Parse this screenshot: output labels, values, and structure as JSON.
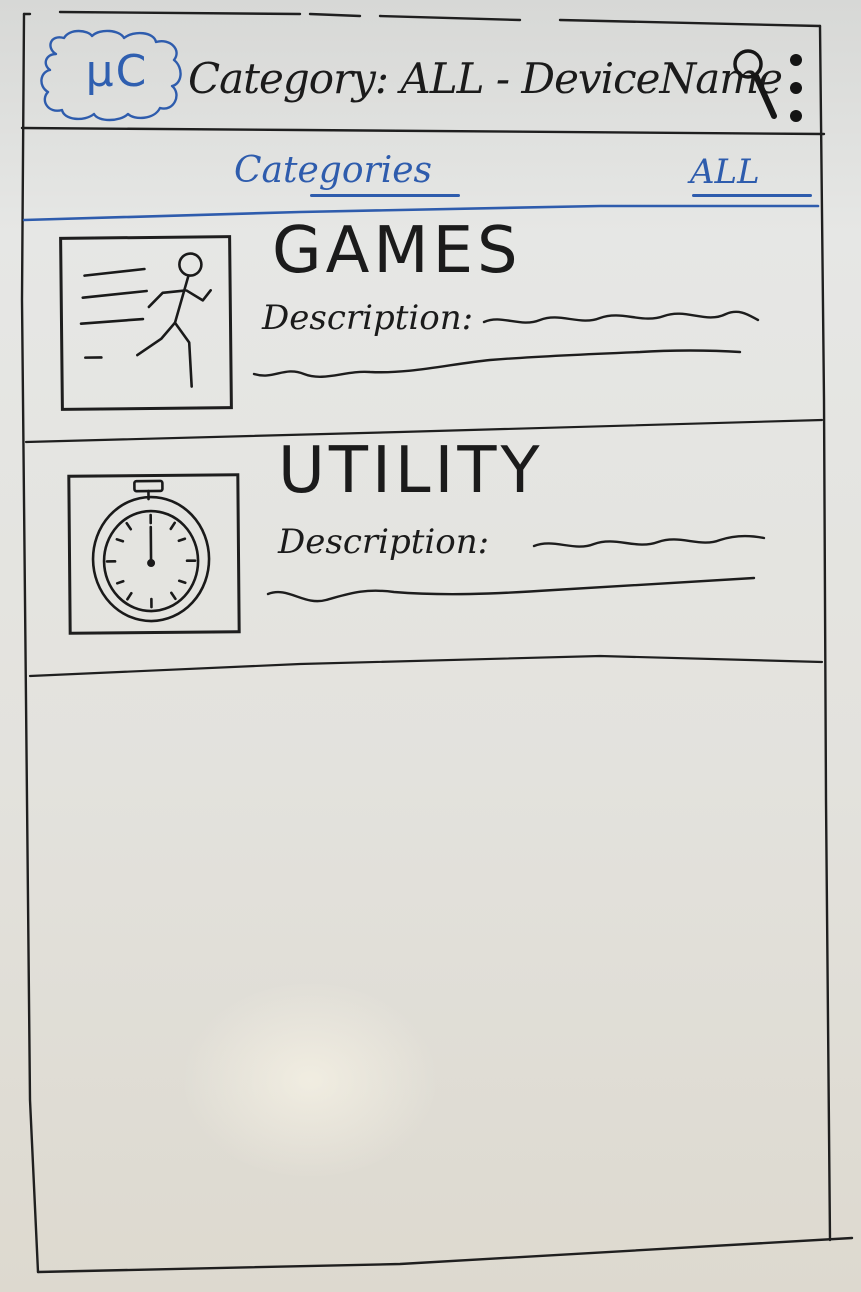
{
  "app": {
    "logo_text": "μC",
    "title": "Category: ALL - DeviceName"
  },
  "header": {
    "search_icon": "search-icon",
    "menu_icon": "more-vert-icon"
  },
  "tabs": [
    {
      "label": "Categories",
      "selected": true
    },
    {
      "label": "ALL",
      "selected": false
    }
  ],
  "categories": [
    {
      "title": "GAMES",
      "description_label": "Description:",
      "icon": "running-figure-icon"
    },
    {
      "title": "UTILITY",
      "description_label": "Description:",
      "icon": "stopwatch-icon"
    }
  ],
  "colors": {
    "accent": "#2e5cad",
    "ink": "#1b1b1b"
  }
}
